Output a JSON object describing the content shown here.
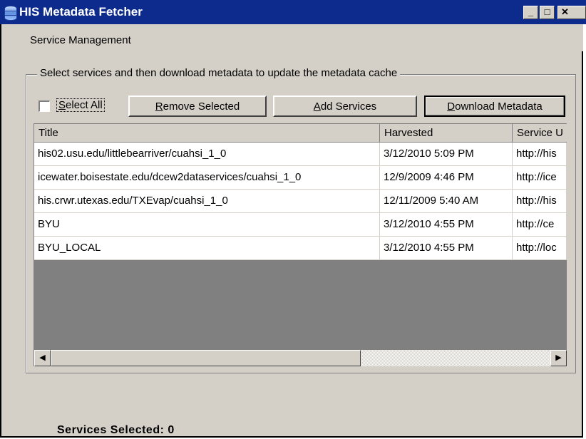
{
  "window": {
    "title": "HIS Metadata Fetcher"
  },
  "menubar": {
    "items": [
      "Service Management"
    ]
  },
  "group": {
    "legend": "Select services and then download metadata to update the metadata cache"
  },
  "toolbar": {
    "select_all_label": "Select All",
    "select_all_checked": false,
    "remove_label": "Remove Selected",
    "add_label": "Add Services",
    "download_label": "Download Metadata"
  },
  "grid": {
    "columns": [
      "Title",
      "Harvested",
      "Service URL"
    ],
    "column_headers_visible": [
      "Title",
      "Harvested",
      "Service U"
    ],
    "rows": [
      {
        "title": "his02.usu.edu/littlebearriver/cuahsi_1_0",
        "harvested": "3/12/2010 5:09 PM",
        "url": "http://his"
      },
      {
        "title": "icewater.boisestate.edu/dcew2dataservices/cuahsi_1_0",
        "harvested": "12/9/2009 4:46 PM",
        "url": "http://ice"
      },
      {
        "title": "his.crwr.utexas.edu/TXEvap/cuahsi_1_0",
        "harvested": "12/11/2009 5:40 AM",
        "url": "http://his"
      },
      {
        "title": "BYU",
        "harvested": "3/12/2010 4:55 PM",
        "url": "http://ce"
      },
      {
        "title": "BYU_LOCAL",
        "harvested": "3/12/2010 4:55 PM",
        "url": "http://loc"
      }
    ]
  },
  "status": {
    "text": "Services Selected: 0"
  }
}
